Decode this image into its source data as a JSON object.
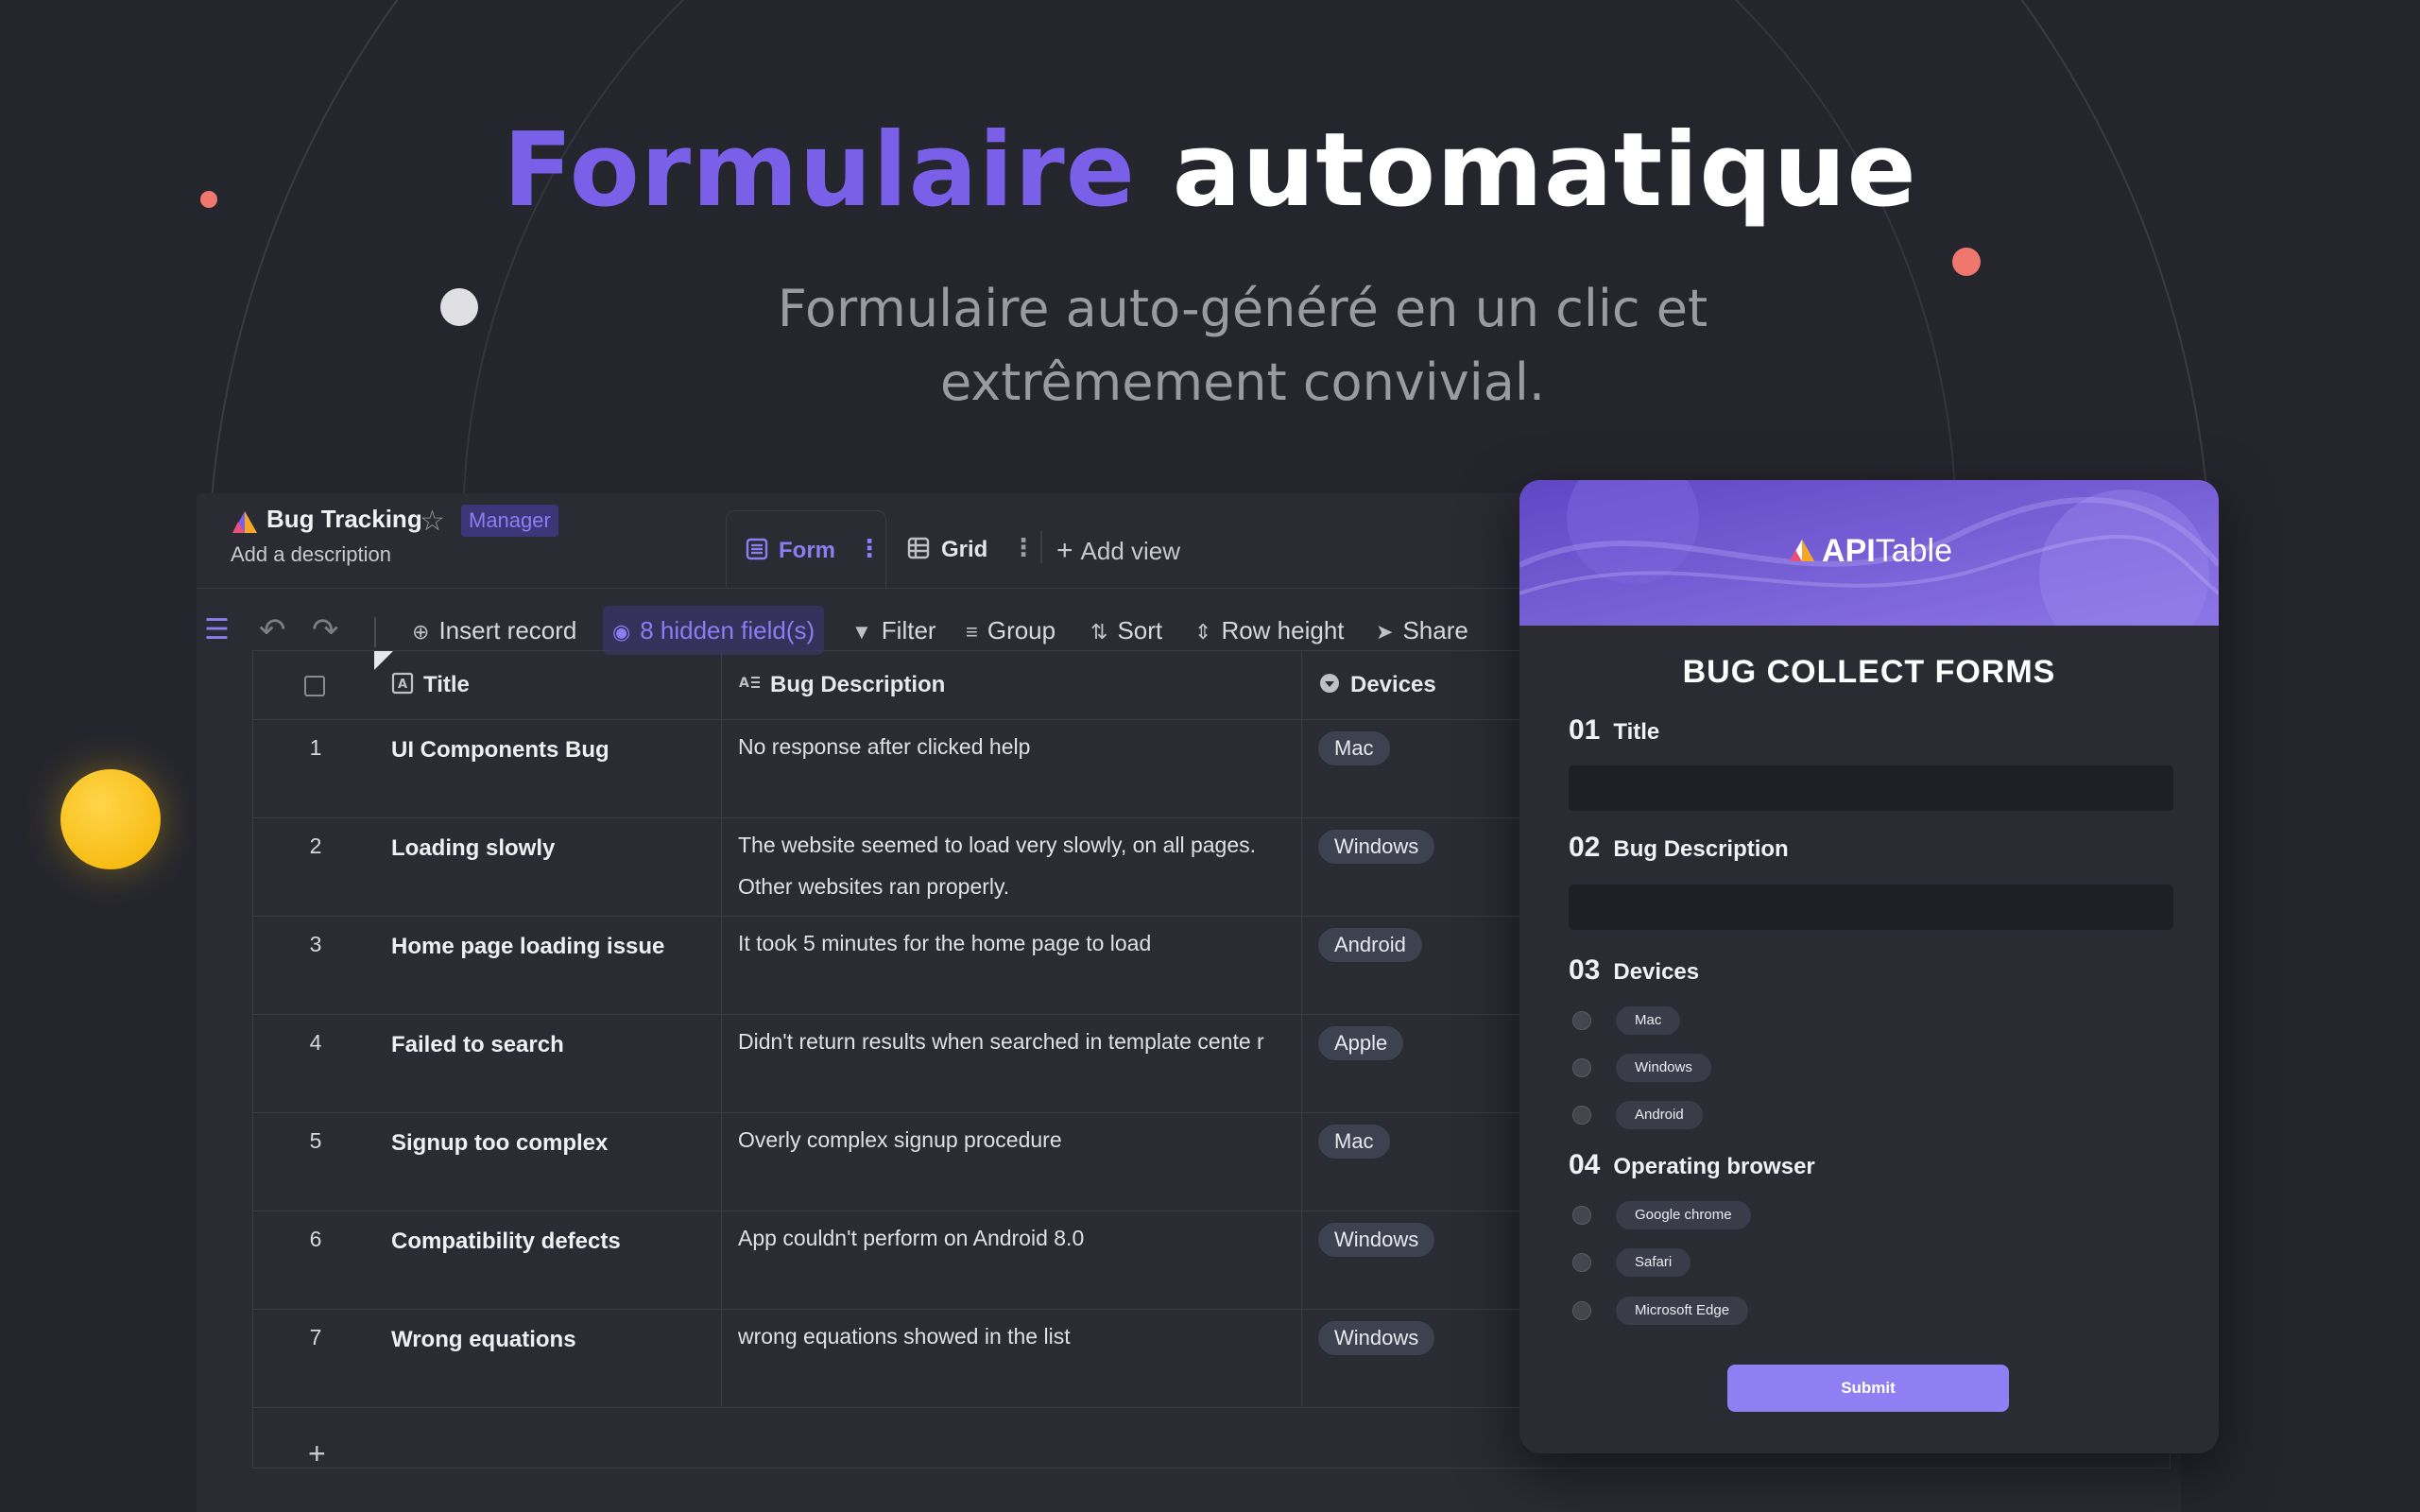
{
  "hero": {
    "title_accent": "Formulaire",
    "title_rest": "automatique",
    "subtitle_line1": "Formulaire auto-généré en un clic et",
    "subtitle_line2": "extrêmement convivial."
  },
  "app": {
    "title": "Bug Tracking",
    "badge": "Manager",
    "description": "Add a description",
    "tabs": [
      {
        "label": "Form",
        "active": true
      },
      {
        "label": "Grid",
        "active": false
      }
    ],
    "add_view": "Add view",
    "toolbar": {
      "insert_record": "Insert record",
      "hidden_fields": "8 hidden field(s)",
      "filter": "Filter",
      "group": "Group",
      "sort": "Sort",
      "row_height": "Row height",
      "share": "Share"
    },
    "columns": [
      "Title",
      "Bug Description",
      "Devices"
    ],
    "rows": [
      {
        "idx": "1",
        "title": "UI Components Bug",
        "desc": "No response after clicked help",
        "device": "Mac"
      },
      {
        "idx": "2",
        "title": "Loading slowly",
        "desc": "The website seemed to load very slowly, on all pages.  Other websites ran properly.",
        "device": "Windows"
      },
      {
        "idx": "3",
        "title": "Home page loading issue",
        "desc": "It took 5 minutes for the home page to load",
        "device": "Android"
      },
      {
        "idx": "4",
        "title": "Failed to search",
        "desc": "Didn't return results when searched in template cente r",
        "device": "Apple"
      },
      {
        "idx": "5",
        "title": "Signup too complex",
        "desc": "Overly complex signup procedure",
        "device": "Mac"
      },
      {
        "idx": "6",
        "title": "Compatibility defects",
        "desc": "App couldn't perform on Android 8.0",
        "device": "Windows"
      },
      {
        "idx": "7",
        "title": "Wrong equations",
        "desc": "wrong equations showed in the list",
        "device": "Windows"
      }
    ],
    "add_row": "+"
  },
  "form": {
    "brand_bold": "API",
    "brand_rest": "Table",
    "heading": "BUG COLLECT FORMS",
    "q1": {
      "num": "01",
      "label": "Title"
    },
    "q2": {
      "num": "02",
      "label": "Bug Description"
    },
    "q3": {
      "num": "03",
      "label": "Devices",
      "options": [
        "Mac",
        "Windows",
        "Android"
      ]
    },
    "q4": {
      "num": "04",
      "label": "Operating browser",
      "options": [
        "Google chrome",
        "Safari",
        "Microsoft Edge"
      ]
    },
    "submit": "Submit"
  },
  "colors": {
    "accent": "#7a5fe8",
    "background": "#25262d",
    "dot_yellow": "#ffc107",
    "dot_coral": "#f0776e"
  }
}
